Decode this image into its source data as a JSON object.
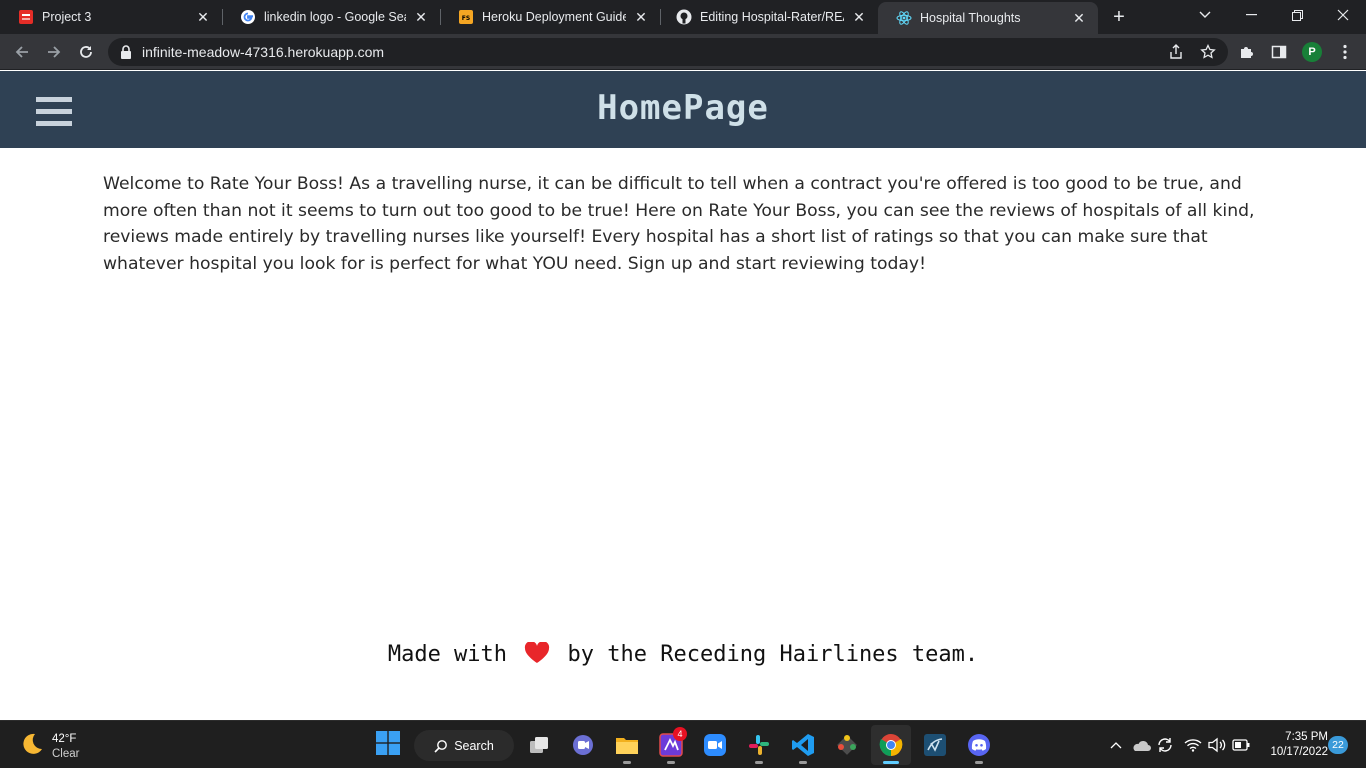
{
  "browser": {
    "tabs": [
      {
        "title": "Project 3",
        "icon": "pdf-icon",
        "active": false
      },
      {
        "title": "linkedin logo - Google Search",
        "icon": "google-icon",
        "active": false
      },
      {
        "title": "Heroku Deployment Guide | T",
        "icon": "fs-icon",
        "active": false
      },
      {
        "title": "Editing Hospital-Rater/READM",
        "icon": "github-icon",
        "active": false
      },
      {
        "title": "Hospital Thoughts",
        "icon": "react-icon",
        "active": true
      }
    ],
    "url": "infinite-meadow-47316.herokuapp.com",
    "profile_initial": "P"
  },
  "page": {
    "title": "HomePage",
    "intro": "Welcome to Rate Your Boss! As a travelling nurse, it can be difficult to tell when a contract you're offered is too good to be true, and more often than not it seems to turn out too good to be true! Here on Rate Your Boss, you can see the reviews of hospitals of all kind, reviews made entirely by travelling nurses like yourself! Every hospital has a short list of ratings so that you can make sure that whatever hospital you look for is perfect for what YOU need. Sign up and start reviewing today!",
    "footer_before": "Made with",
    "footer_after": "by the Receding Hairlines team."
  },
  "taskbar": {
    "weather_temp": "42°F",
    "weather_cond": "Clear",
    "search_label": "Search",
    "badge_count": "4",
    "time": "7:35 PM",
    "date": "10/17/2022",
    "notification_count": "22"
  },
  "colors": {
    "header_bg": "#2f4154",
    "title_text": "#cfe0e8",
    "heart": "#e8262a"
  }
}
